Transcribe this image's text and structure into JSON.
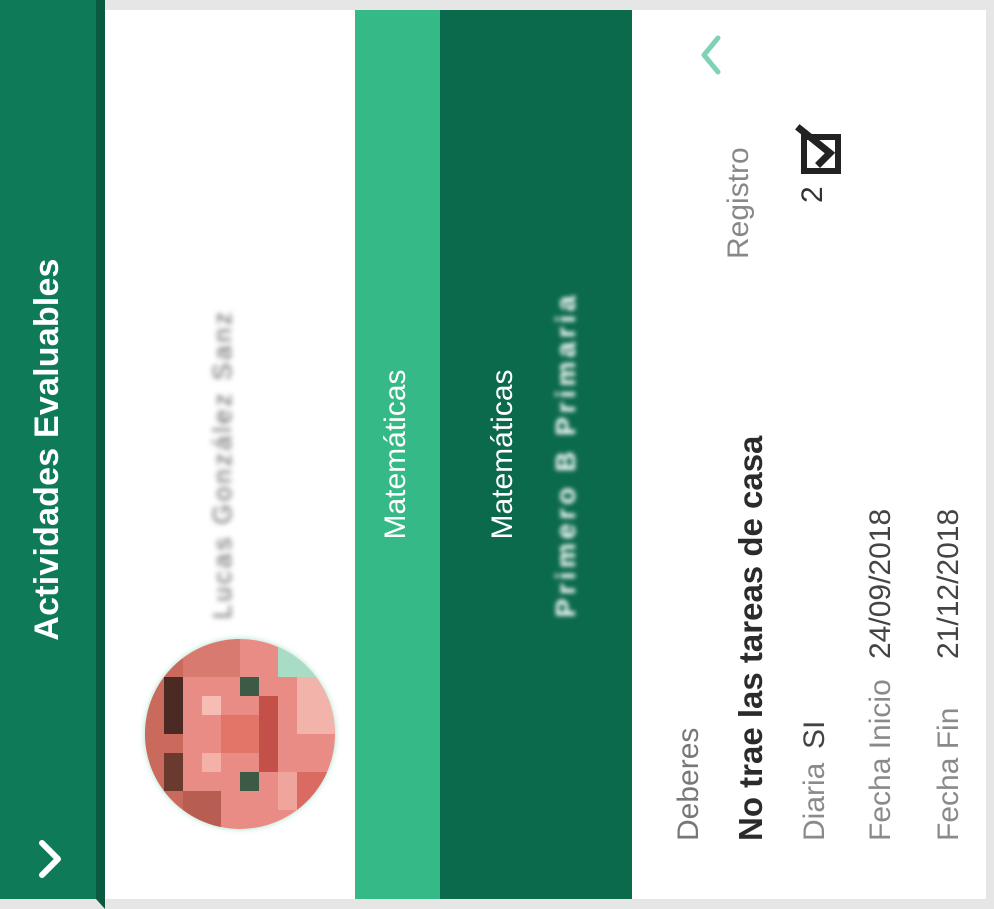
{
  "header": {
    "title": "Actividades Evaluables",
    "back_icon": "chevron-down-icon"
  },
  "profile": {
    "name": "Lucas González Sanz"
  },
  "subject_band": {
    "label": "Matemáticas"
  },
  "activity_card": {
    "subject": "Matemáticas",
    "subtitle": "Primero B Primaria"
  },
  "details": {
    "category": "Deberes",
    "title": "No trae las tareas de casa",
    "registro_label": "Registro",
    "registro_count": "2",
    "registro_icon": "checkbox-check-icon",
    "collapse_icon": "chevron-up-icon",
    "frequency_label": "Diaria",
    "frequency_value": "SI",
    "start_label": "Fecha Inicio",
    "start_value": "24/09/2018",
    "end_label": "Fecha Fin",
    "end_value": "21/12/2018"
  },
  "colors": {
    "header": "#0e7a58",
    "subject_band": "#35b986",
    "activity_card": "#0b6a4c",
    "accent_light": "#7fd3b4"
  }
}
